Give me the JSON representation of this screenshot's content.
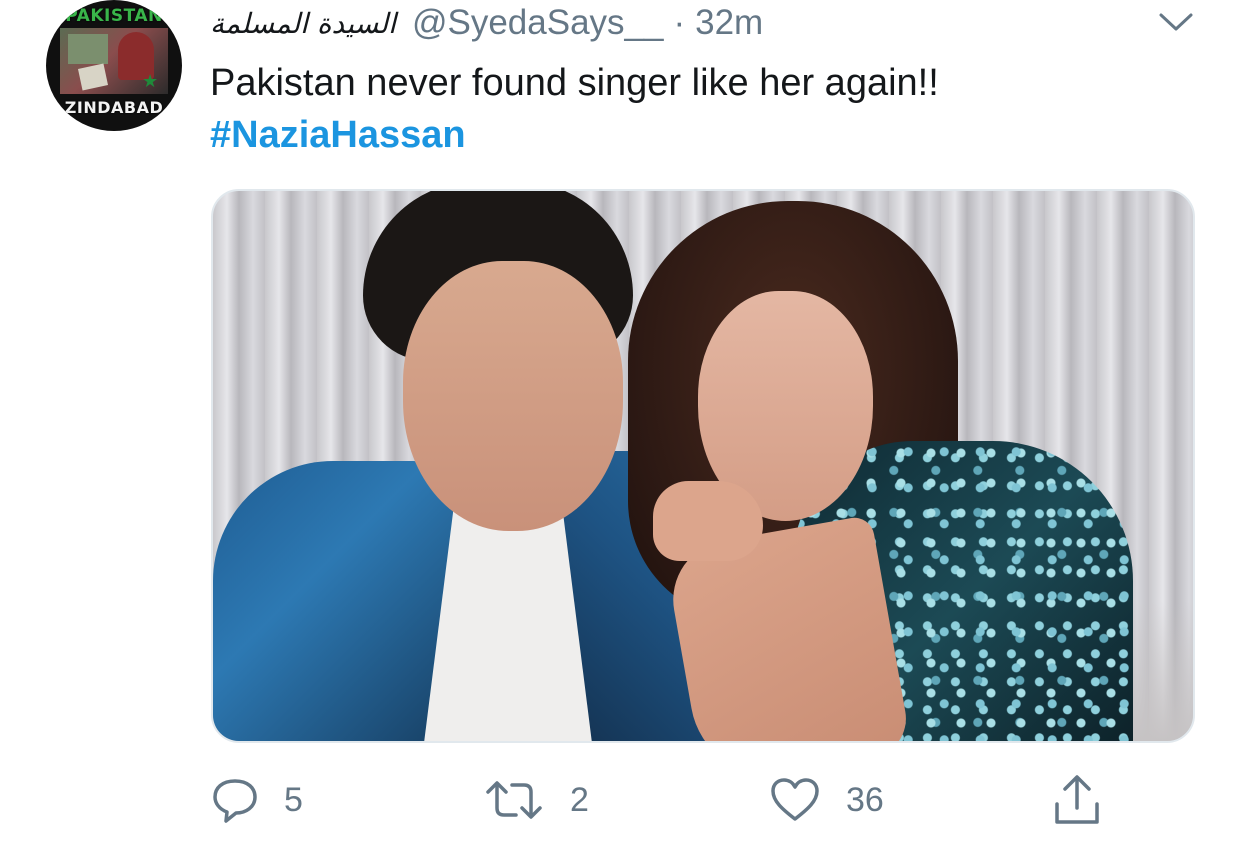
{
  "avatar": {
    "top_text": "PAKISTAN",
    "bottom_text": "ZINDABAD"
  },
  "tweet": {
    "display_name": "السيدة المسلمة",
    "handle": "@SyedaSays__",
    "separator": "·",
    "time": "32m",
    "text": "Pakistan never found singer like her again!!",
    "hashtag": "#NaziaHassan"
  },
  "actions": {
    "reply_count": "5",
    "retweet_count": "2",
    "like_count": "36"
  },
  "icons": {
    "more": "chevron-down-icon",
    "reply": "reply-icon",
    "retweet": "retweet-icon",
    "like": "heart-icon",
    "share": "share-icon"
  },
  "colors": {
    "text": "#14171a",
    "secondary": "#657786",
    "link": "#1b95e0",
    "border": "#e1e8ed"
  }
}
